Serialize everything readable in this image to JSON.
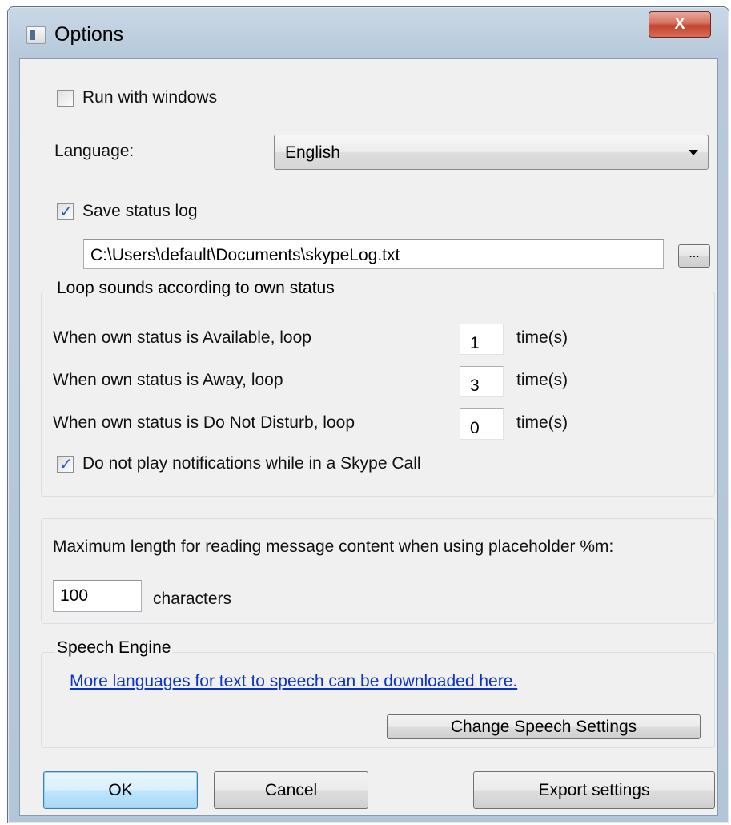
{
  "window": {
    "title": "Options",
    "close_label": "X"
  },
  "general": {
    "run_with_windows": {
      "label": "Run with windows",
      "checked": false
    },
    "language": {
      "label": "Language:",
      "selected": "English"
    },
    "save_status_log": {
      "label": "Save status log",
      "checked": true
    },
    "log_path": "C:\\Users\\default\\Documents\\skypeLog.txt",
    "browse_label": "..."
  },
  "loop_sounds": {
    "legend": "Loop sounds according to own status",
    "rows": [
      {
        "label": "When own status is Available, loop",
        "value": "1",
        "unit": "time(s)"
      },
      {
        "label": "When own status is Away, loop",
        "value": "3",
        "unit": "time(s)"
      },
      {
        "label": "When own status is Do Not Disturb, loop",
        "value": "0",
        "unit": "time(s)"
      }
    ],
    "no_notifications_in_call": {
      "label": "Do not play notifications while in a Skype Call",
      "checked": true
    }
  },
  "message_length": {
    "label": "Maximum length for reading message content when using placeholder %m:",
    "value": "100",
    "unit": "characters"
  },
  "speech_engine": {
    "legend": "Speech Engine",
    "link": "More languages for text to speech can be downloaded here.",
    "change_button": "Change Speech Settings"
  },
  "footer": {
    "ok": "OK",
    "cancel": "Cancel",
    "export": "Export settings"
  },
  "colors": {
    "link": "#0a33cc",
    "close_button": "#c2432d",
    "default_button": "#bee6fd",
    "check_mark": "#2a5fb3"
  }
}
